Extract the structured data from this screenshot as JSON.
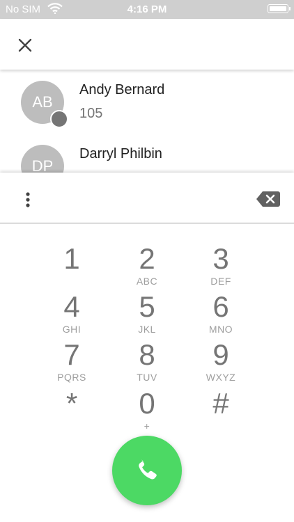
{
  "status_bar": {
    "carrier": "No SIM",
    "time": "4:16 PM"
  },
  "results": [
    {
      "initials": "AB",
      "name": "Andy Bernard",
      "number": "105"
    },
    {
      "initials": "DP",
      "name": "Darryl Philbin",
      "number": ""
    }
  ],
  "keypad": [
    {
      "digit": "1",
      "letters": ""
    },
    {
      "digit": "2",
      "letters": "ABC"
    },
    {
      "digit": "3",
      "letters": "DEF"
    },
    {
      "digit": "4",
      "letters": "GHI"
    },
    {
      "digit": "5",
      "letters": "JKL"
    },
    {
      "digit": "6",
      "letters": "MNO"
    },
    {
      "digit": "7",
      "letters": "PQRS"
    },
    {
      "digit": "8",
      "letters": "TUV"
    },
    {
      "digit": "9",
      "letters": "WXYZ"
    },
    {
      "digit": "*",
      "letters": ""
    },
    {
      "digit": "0",
      "letters": "+"
    },
    {
      "digit": "#",
      "letters": ""
    }
  ],
  "icons": {
    "close": "close-icon",
    "more": "more-vert-icon",
    "backspace": "backspace-icon",
    "call": "phone-icon",
    "badge": "phone-icon",
    "wifi": "wifi-icon",
    "battery": "battery-icon"
  },
  "colors": {
    "status_bar": "#cfcfcf",
    "avatar": "#bdbdbd",
    "call_button": "#4cd964",
    "digit": "#757575"
  }
}
